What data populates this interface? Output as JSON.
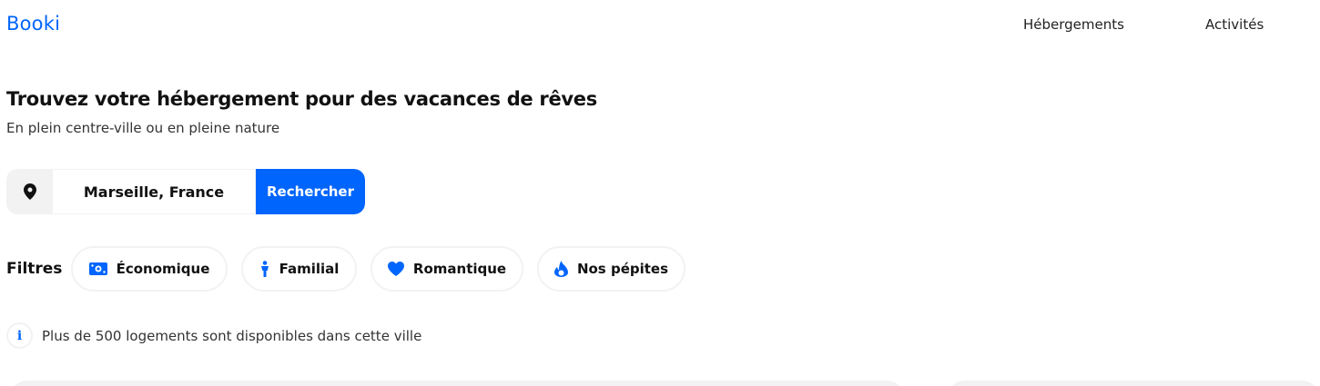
{
  "header": {
    "logo": "Booki",
    "nav": [
      "Hébergements",
      "Activités"
    ]
  },
  "hero": {
    "title": "Trouvez votre hébergement pour des vacances de rêves",
    "subtitle": "En plein centre-ville ou en pleine nature"
  },
  "search": {
    "value": "Marseille, France",
    "button_label": "Rechercher",
    "icon": "location-pin-icon"
  },
  "filters": {
    "label": "Filtres",
    "items": [
      {
        "label": "Économique",
        "icon": "money-icon"
      },
      {
        "label": "Familial",
        "icon": "person-icon"
      },
      {
        "label": "Romantique",
        "icon": "heart-icon"
      },
      {
        "label": "Nos pépites",
        "icon": "fire-icon"
      }
    ]
  },
  "info": {
    "icon_glyph": "i",
    "text": "Plus de 500 logements sont disponibles dans cette ville"
  },
  "colors": {
    "accent": "#0065fc",
    "chip_border": "#f2f2f2",
    "pin_bg": "#f2f2f2"
  }
}
